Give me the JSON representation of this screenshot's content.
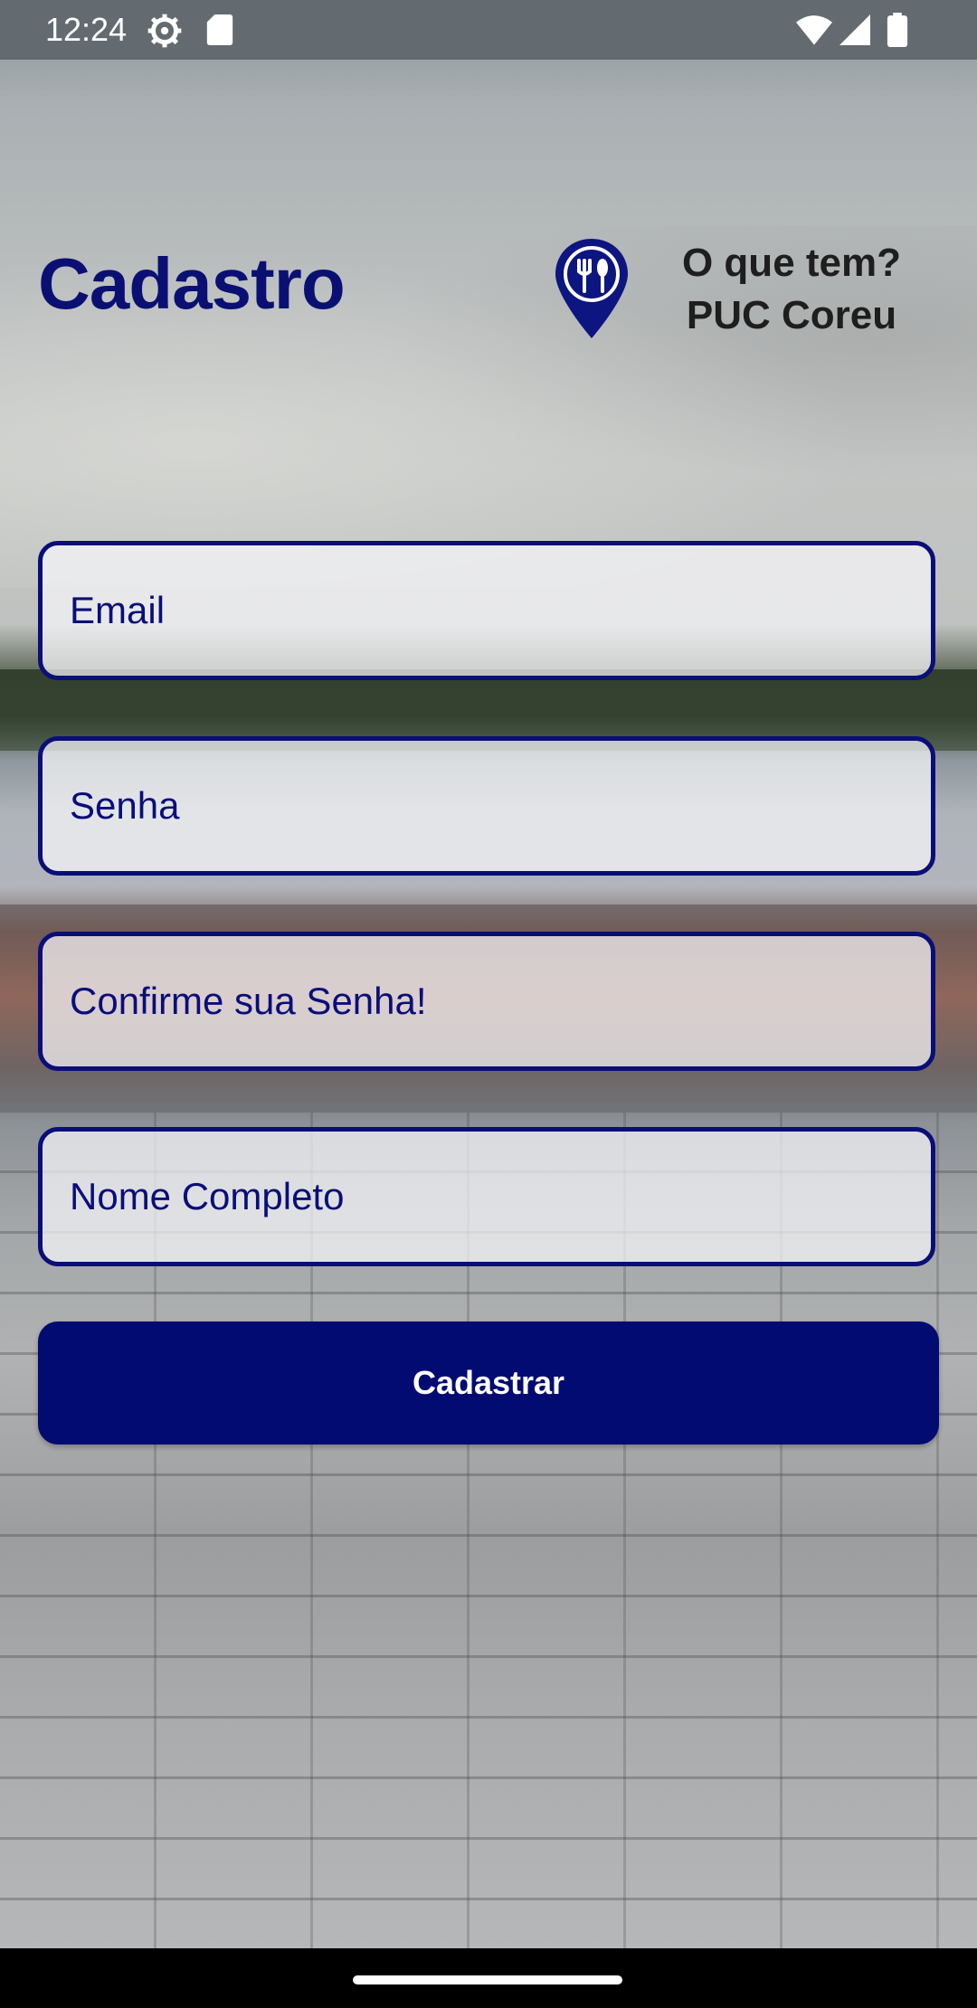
{
  "status_bar": {
    "time": "12:24",
    "icons": [
      "gear-icon",
      "sd-card-icon",
      "wifi-icon",
      "signal-icon",
      "battery-icon"
    ]
  },
  "header": {
    "title": "Cadastro",
    "logo_icon": "location-pin-utensils-icon",
    "app_name_line1": "O que tem?",
    "app_name_line2": "PUC Coreu"
  },
  "form": {
    "email_placeholder": "Email",
    "password_placeholder": "Senha",
    "confirm_password_placeholder": "Confirme sua Senha!",
    "full_name_placeholder": "Nome Completo",
    "submit_label": "Cadastrar"
  },
  "colors": {
    "primary": "#0a0e78",
    "button": "#020b72",
    "logo_text": "#1e1e1e"
  }
}
